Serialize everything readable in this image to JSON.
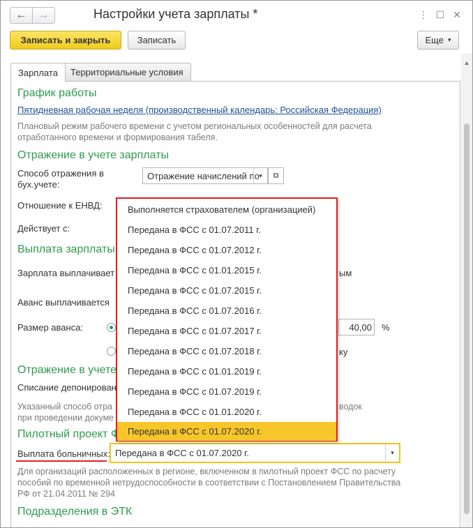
{
  "window": {
    "title": "Настройки учета зарплаты *",
    "back_icon": "←",
    "forward_icon": "→",
    "menu_icon": "⋮",
    "maximize_icon": "☐",
    "close_icon": "✕"
  },
  "toolbar": {
    "save_close_label": "Записать и закрыть",
    "save_label": "Записать",
    "more_label": "Еще",
    "more_arrow": "▾"
  },
  "tabs": [
    {
      "label": "Зарплата",
      "active": true
    },
    {
      "label": "Территориальные условия",
      "active": false
    }
  ],
  "schedule": {
    "heading": "График работы",
    "link": "Пятидневная рабочая неделя (производственный календарь: Российская Федерация)",
    "hint_line1": "Плановый режим рабочего времени с учетом региональных особенностей для расчета",
    "hint_line2": "отработанного времени и формирования табеля."
  },
  "accounting": {
    "heading": "Отражение в учете зарплаты",
    "method_label_line1": "Способ отражения в",
    "method_label_line2": "бух.учете:",
    "method_value": "Отражение начислений по",
    "envd_label": "Отношение к ЕНВД:",
    "valid_from_label": "Действует с:"
  },
  "payment": {
    "heading": "Выплата зарплаты",
    "salary_paid_label": "Зарплата выплачивает",
    "salary_paid_tail": "ым",
    "advance_paid_label": "Аванс выплачивается",
    "advance_size_label": "Размер аванса:",
    "advance_value": "40,00",
    "percent_sign": "%",
    "advance_tail": "ку"
  },
  "deposit": {
    "heading": "Отражение в учете",
    "writeoff_label": "Списание депонирован",
    "hint_line1": "Указанный способ отра",
    "hint_line1_tail": "водок",
    "hint_line2": "при проведении докуме"
  },
  "pilot": {
    "heading": "Пилотный проект Ф",
    "sick_pay_label": "Выплата больничных:",
    "sick_pay_value": "Передана в ФСС с 01.07.2020 г.",
    "hint_line1": "Для организаций расположенных в регионе, включенном в пилотный проект ФСС по расчету",
    "hint_line2": "пособий по временной нетрудоспособности в соответствии с Постановлением Правительства",
    "hint_line3": "РФ от 21.04.2011 № 294"
  },
  "departments": {
    "heading": "Подразделения в ЭТК"
  },
  "dropdown_arrow": "▾",
  "open_icon": "⧉",
  "popup_options": [
    "Выполняется страхователем (организацией)",
    "Передана в ФСС с 01.07.2011 г.",
    "Передана в ФСС с 01.07.2012 г.",
    "Передана в ФСС с 01.01.2015 г.",
    "Передана в ФСС с 01.07.2015 г.",
    "Передана в ФСС с 01.07.2016 г.",
    "Передана в ФСС с 01.07.2017 г.",
    "Передана в ФСС с 01.07.2018 г.",
    "Передана в ФСС с 01.01.2019 г.",
    "Передана в ФСС с 01.07.2019 г.",
    "Передана в ФСС с 01.01.2020 г.",
    "Передана в ФСС с 01.07.2020 г."
  ],
  "popup_selected_index": 11,
  "colors": {
    "section_green": "#2e9b4f",
    "accent_yellow": "#f7c62a",
    "highlight_red": "#e02020",
    "link_blue": "#1f4f99"
  }
}
